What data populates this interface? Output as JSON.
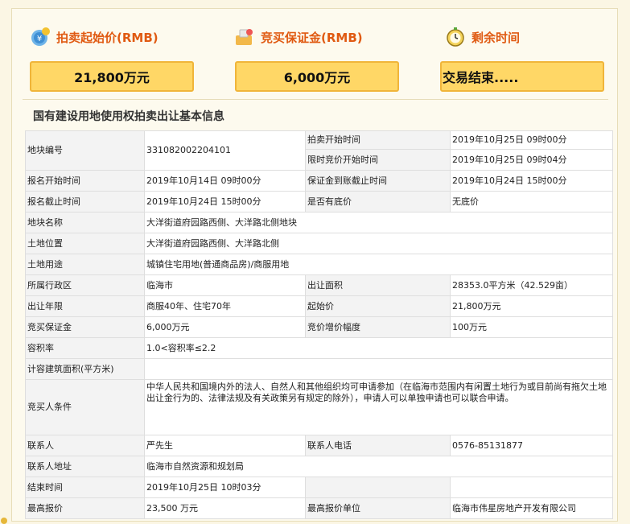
{
  "header": {
    "start_price": {
      "label": "拍卖起始价(RMB)",
      "value": "21,800万元",
      "icon": "money-bag-icon"
    },
    "deposit": {
      "label": "竞买保证金(RMB)",
      "value": "6,000万元",
      "icon": "deposit-icon"
    },
    "remaining": {
      "label": "剩余时间",
      "value": "交易结束.....",
      "icon": "alarm-clock-icon"
    }
  },
  "section_title": "国有建设用地使用权拍卖出让基本信息",
  "table": {
    "parcel_no": {
      "label": "地块编号",
      "value": "331082002204101"
    },
    "auction_start": {
      "label": "拍卖开始时间",
      "value": "2019年10月25日 09时00分"
    },
    "timed_bid_start": {
      "label": "限时竞价开始时间",
      "value": "2019年10月25日 09时04分"
    },
    "reg_start": {
      "label": "报名开始时间",
      "value": "2019年10月14日 09时00分"
    },
    "deposit_deadline": {
      "label": "保证金到账截止时间",
      "value": "2019年10月24日 15时00分"
    },
    "reg_deadline": {
      "label": "报名截止时间",
      "value": "2019年10月24日 15时00分"
    },
    "reserve_price": {
      "label": "是否有底价",
      "value": "无底价"
    },
    "parcel_name": {
      "label": "地块名称",
      "value": "大洋街道府园路西侧、大洋路北侧地块"
    },
    "location": {
      "label": "土地位置",
      "value": "大洋街道府园路西侧、大洋路北侧"
    },
    "usage": {
      "label": "土地用途",
      "value": "城镇住宅用地(普通商品房)/商服用地"
    },
    "district": {
      "label": "所属行政区",
      "value": "临海市"
    },
    "area": {
      "label": "出让面积",
      "value": "28353.0平方米（42.529亩）"
    },
    "term": {
      "label": "出让年限",
      "value": "商服40年、住宅70年"
    },
    "start_price": {
      "label": "起始价",
      "value": "21,800万元"
    },
    "deposit": {
      "label": "竞买保证金",
      "value": "6,000万元"
    },
    "increment": {
      "label": "竞价增价幅度",
      "value": "100万元"
    },
    "far": {
      "label": "容积率",
      "value": "1.0<容积率≤2.2"
    },
    "gfa": {
      "label": "计容建筑面积(平方米)",
      "value": ""
    },
    "bidder_conditions": {
      "label": "竞买人条件",
      "value": "中华人民共和国境内外的法人、自然人和其他组织均可申请参加（在临海市范围内有闲置土地行为或目前尚有拖欠土地出让金行为的、法律法规及有关政策另有规定的除外），申请人可以单独申请也可以联合申请。"
    },
    "contact": {
      "label": "联系人",
      "value": "严先生"
    },
    "phone": {
      "label": "联系人电话",
      "value": "0576-85131877"
    },
    "address": {
      "label": "联系人地址",
      "value": "临海市自然资源和规划局"
    },
    "end_time": {
      "label": "结束时间",
      "value": "2019年10月25日 10时03分"
    },
    "highest_bid": {
      "label": "最高报价",
      "value": "23,500 万元"
    },
    "highest_bidder": {
      "label": "最高报价单位",
      "value": "临海市伟星房地产开发有限公司"
    }
  },
  "colors": {
    "accent": "#e05a12",
    "box_fill": "#ffd766",
    "box_border": "#f0b53a"
  }
}
